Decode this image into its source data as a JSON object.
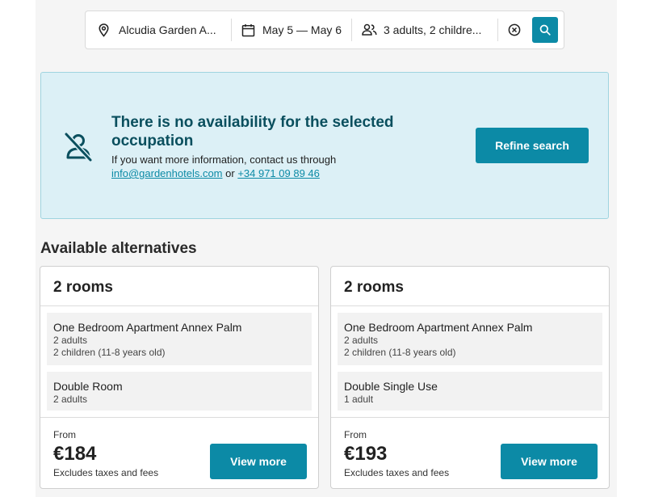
{
  "search": {
    "hotel": "Alcudia Garden A...",
    "dates": "May 5 — May 6",
    "guests": "3 adults, 2 childre..."
  },
  "alert": {
    "title": "There is no availability for the selected occupation",
    "body_prefix": "If you want more information, contact us through",
    "email": "info@gardenhotels.com",
    "or": "or",
    "phone": "+34 971 09 89 46",
    "refine_label": "Refine search"
  },
  "alternatives": {
    "heading": "Available alternatives",
    "cards": [
      {
        "title": "2 rooms",
        "rooms": [
          {
            "name": "One Bedroom Apartment Annex Palm",
            "lines": [
              "2 adults",
              "2 children (11-8 years old)"
            ]
          },
          {
            "name": "Double Room",
            "lines": [
              "2 adults"
            ]
          }
        ],
        "from": "From",
        "price": "€184",
        "taxes": "Excludes taxes and fees",
        "button": "View more"
      },
      {
        "title": "2 rooms",
        "rooms": [
          {
            "name": "One Bedroom Apartment Annex Palm",
            "lines": [
              "2 adults",
              "2 children (11-8 years old)"
            ]
          },
          {
            "name": "Double Single Use",
            "lines": [
              "1 adult"
            ]
          }
        ],
        "from": "From",
        "price": "€193",
        "taxes": "Excludes taxes and fees",
        "button": "View more"
      }
    ]
  },
  "icons": {
    "location": "location-pin-icon",
    "calendar": "calendar-icon",
    "guests": "guests-icon",
    "clear": "clear-circle-icon",
    "search": "search-icon",
    "no_availability": "no-person-icon"
  },
  "colors": {
    "accent": "#0c8aa6",
    "alert_bg": "#dcf0f6",
    "alert_title": "#0a4f5e"
  }
}
